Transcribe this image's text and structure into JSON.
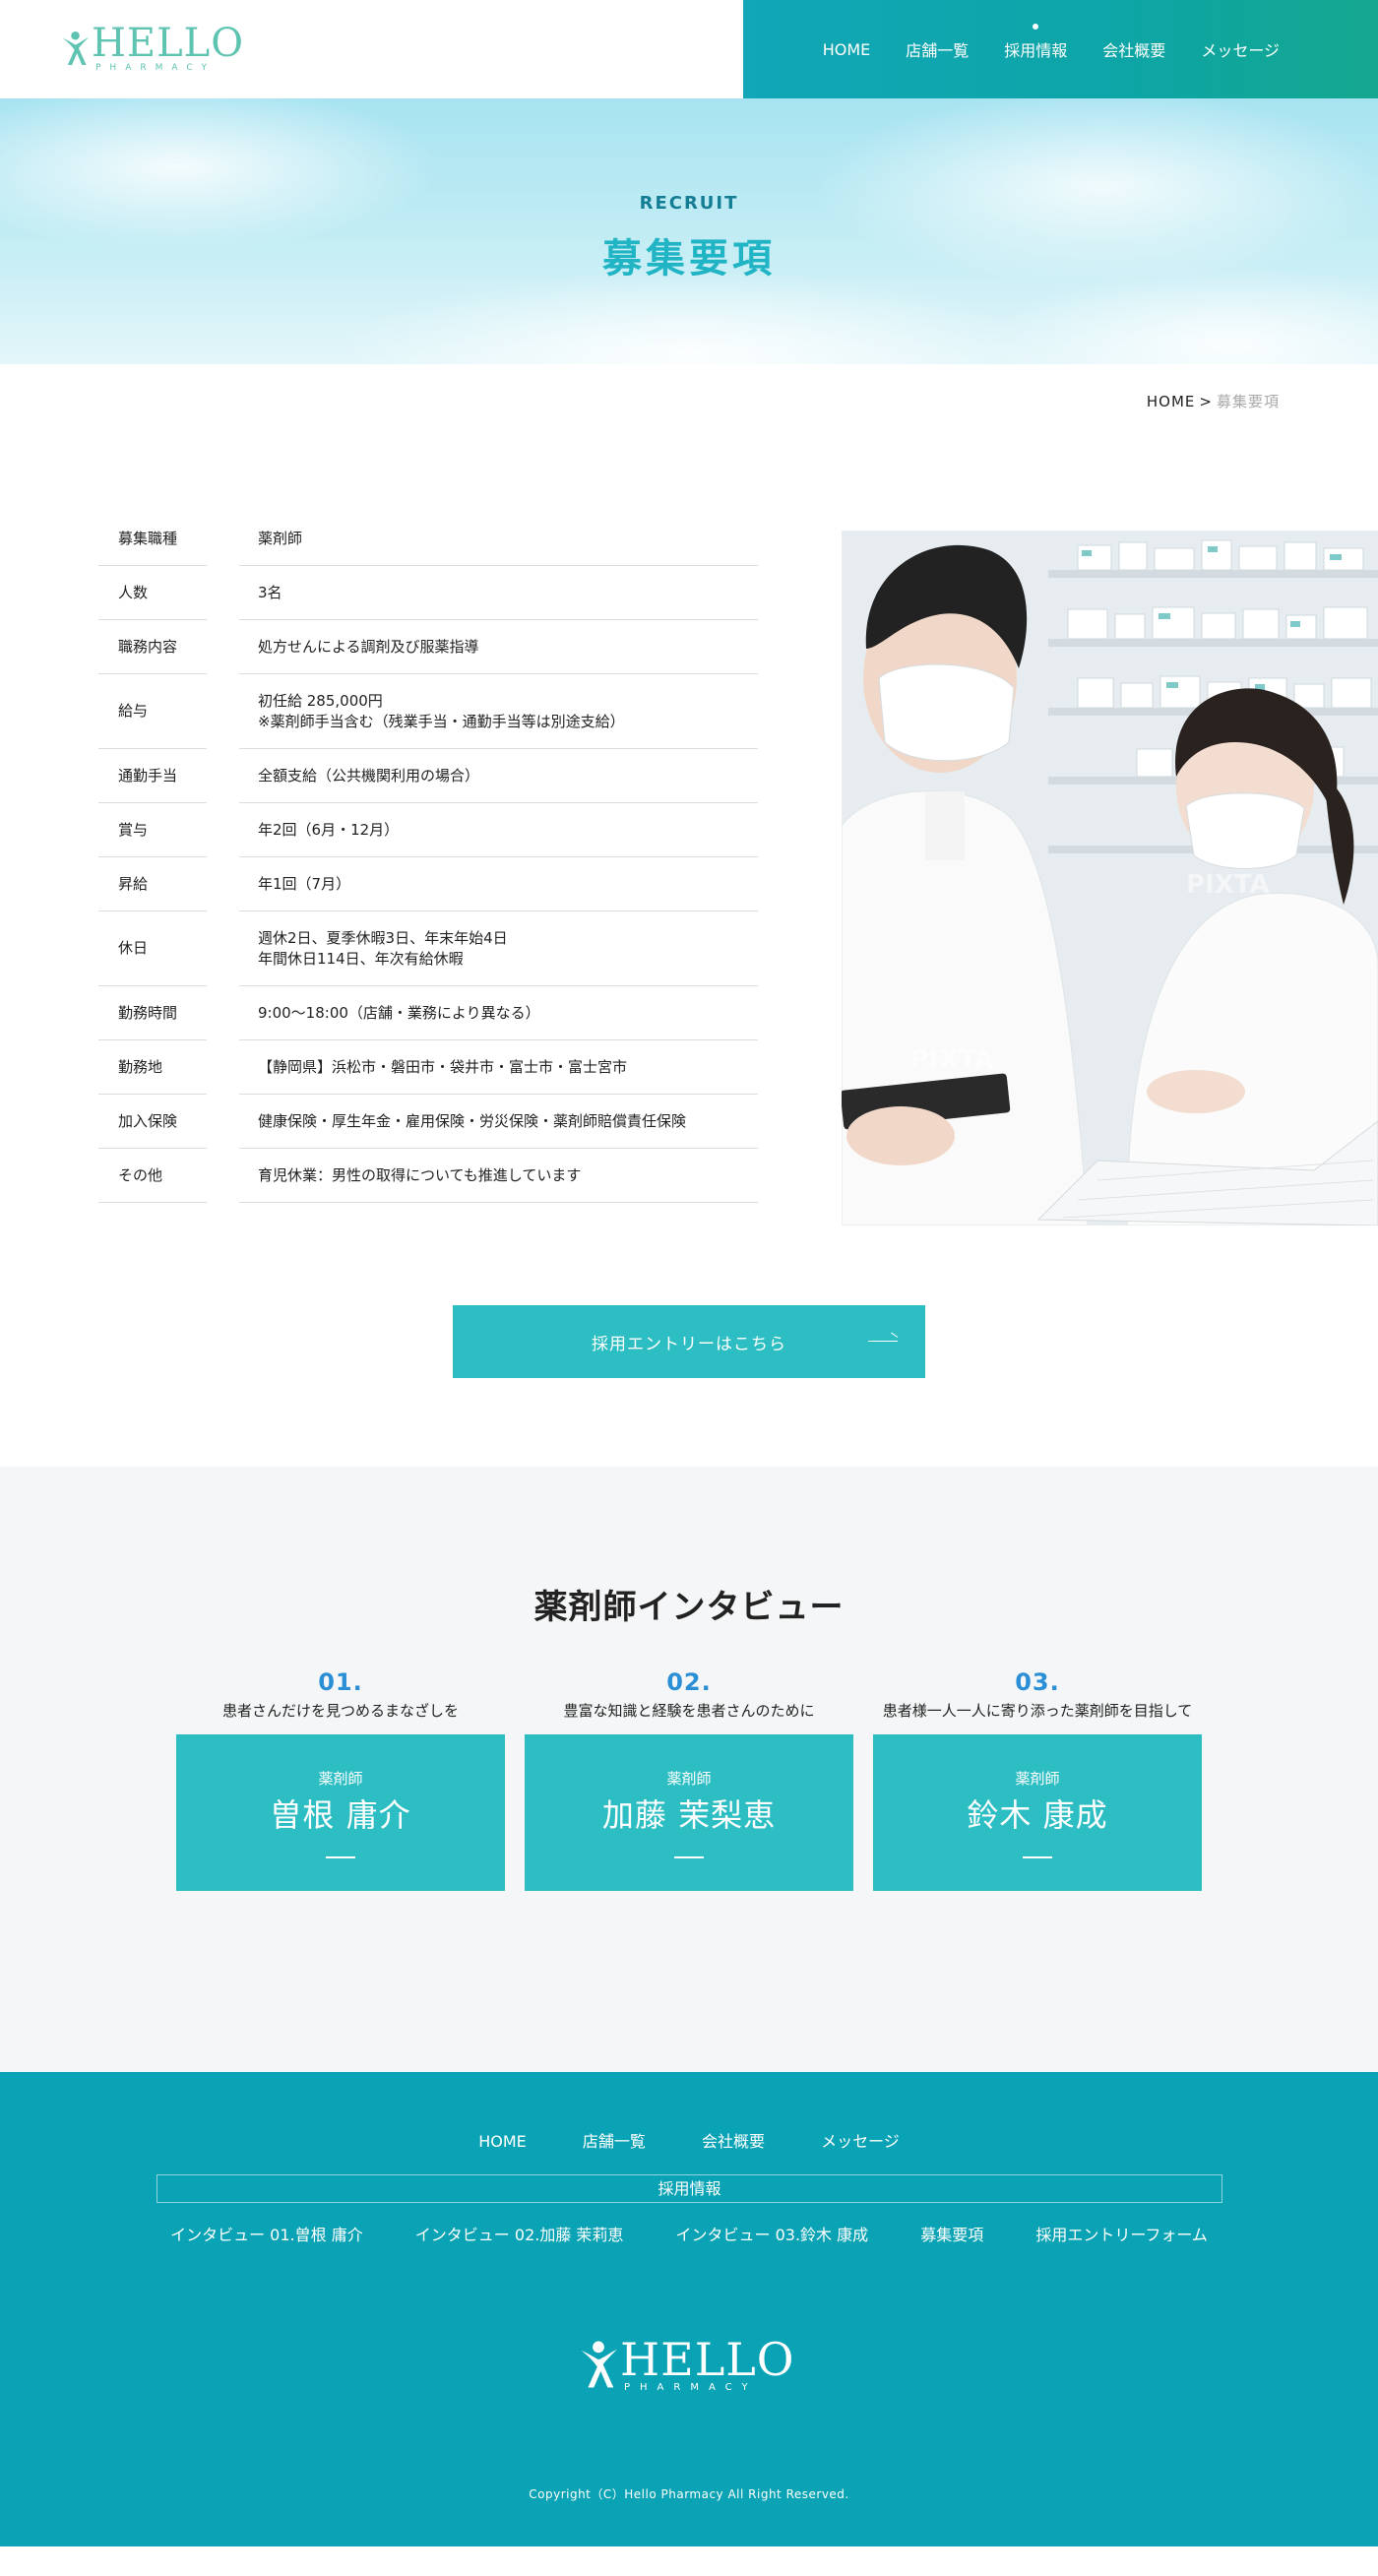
{
  "header": {
    "logo": {
      "main": "HELLO",
      "sub": "PHARMACY"
    },
    "nav": [
      "HOME",
      "店舗一覧",
      "採用情報",
      "会社概要",
      "メッセージ"
    ],
    "active_nav": "採用情報"
  },
  "hero": {
    "eyebrow": "RECRUIT",
    "title": "募集要項"
  },
  "breadcrumb": {
    "home": "HOME",
    "separator": ">",
    "current": "募集要項"
  },
  "recruit_table": [
    {
      "label": "募集職種",
      "lines": [
        "薬剤師"
      ]
    },
    {
      "label": "人数",
      "lines": [
        "3名"
      ]
    },
    {
      "label": "職務内容",
      "lines": [
        "処方せんによる調剤及び服薬指導"
      ]
    },
    {
      "label": "給与",
      "lines": [
        "初任給 285,000円",
        "※薬剤師手当含む（残業手当・通勤手当等は別途支給）"
      ]
    },
    {
      "label": "通勤手当",
      "lines": [
        "全額支給（公共機関利用の場合）"
      ]
    },
    {
      "label": "賞与",
      "lines": [
        "年2回（6月・12月）"
      ]
    },
    {
      "label": "昇給",
      "lines": [
        "年1回（7月）"
      ]
    },
    {
      "label": "休日",
      "lines": [
        "週休2日、夏季休暇3日、年末年始4日",
        "年間休日114日、年次有給休暇"
      ]
    },
    {
      "label": "勤務時間",
      "lines": [
        "9:00〜18:00（店舗・業務により異なる）"
      ]
    },
    {
      "label": "勤務地",
      "lines": [
        "【静岡県】浜松市・磐田市・袋井市・富士市・富士宮市"
      ]
    },
    {
      "label": "加入保険",
      "lines": [
        "健康保険・厚生年金・雇用保険・労災保険・薬剤師賠償責任保険"
      ]
    },
    {
      "label": "その他",
      "lines": [
        "育児休業：男性の取得についても推進しています"
      ]
    }
  ],
  "photo": {
    "watermark": "PIXTA"
  },
  "entry": {
    "label": "採用エントリーはこちら"
  },
  "interview": {
    "title": "薬剤師インタビュー",
    "cards": [
      {
        "num": "01.",
        "catch": "患者さんだけを見つめるまなざしを",
        "role": "薬剤師",
        "name": "曽根 庸介"
      },
      {
        "num": "02.",
        "catch": "豊富な知識と経験を患者さんのために",
        "role": "薬剤師",
        "name": "加藤 茉梨恵"
      },
      {
        "num": "03.",
        "catch": "患者様一人一人に寄り添った薬剤師を目指して",
        "role": "薬剤師",
        "name": "鈴木 康成"
      }
    ]
  },
  "footer": {
    "nav": [
      "HOME",
      "店舗一覧",
      "会社概要",
      "メッセージ"
    ],
    "recruit_heading": "採用情報",
    "recruit_links": [
      "インタビュー 01.曽根 庸介",
      "インタビュー 02.加藤 茉莉恵",
      "インタビュー 03.鈴木 康成",
      "募集要項",
      "採用エントリーフォーム"
    ],
    "logo": {
      "main": "HELLO",
      "sub": "PHARMACY"
    },
    "copyright": "Copyright（C）Hello Pharmacy All Right Reserved."
  },
  "colors": {
    "teal": "#2dbec4",
    "footer_bg": "#0aa3b5",
    "accent_blue": "#2b8fd6",
    "logo_green": "#5ec3b0"
  }
}
